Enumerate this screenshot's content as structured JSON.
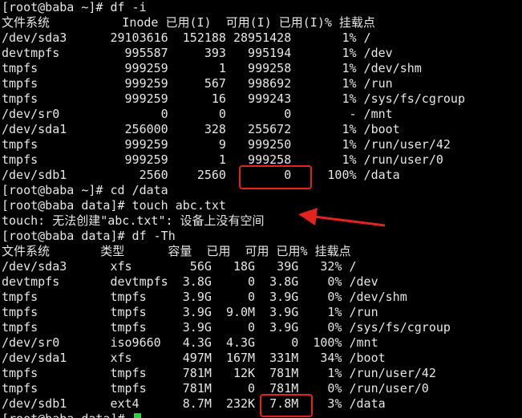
{
  "terminal": {
    "lines": [
      "[root@baba ~]# df -i",
      "文件系统          Inode 已用(I)  可用(I) 已用(I)% 挂载点",
      "/dev/sda3      29103616  152188 28951428       1% /",
      "devtmpfs         995587     393   995194       1% /dev",
      "tmpfs            999259       1   999258       1% /dev/shm",
      "tmpfs            999259     567   998692       1% /run",
      "tmpfs            999259      16   999243       1% /sys/fs/cgroup",
      "/dev/sr0              0       0        0        - /mnt",
      "/dev/sda1        256000     328   255672       1% /boot",
      "tmpfs            999259       9   999250       1% /run/user/42",
      "tmpfs            999259       1   999258       1% /run/user/0",
      "/dev/sdb1          2560    2560        0     100% /data",
      "[root@baba ~]# cd /data",
      "[root@baba data]# touch abc.txt",
      "touch: 无法创建\"abc.txt\": 设备上没有空间",
      "[root@baba data]# df -Th",
      "文件系统       类型      容量  已用  可用 已用% 挂载点",
      "/dev/sda3      xfs        56G   18G   39G   32% /",
      "devtmpfs       devtmpfs  3.8G     0  3.8G    0% /dev",
      "tmpfs          tmpfs     3.9G     0  3.9G    0% /dev/shm",
      "tmpfs          tmpfs     3.9G  9.0M  3.9G    1% /run",
      "tmpfs          tmpfs     3.9G     0  3.9G    0% /sys/fs/cgroup",
      "/dev/sr0       iso9660   4.3G  4.3G     0  100% /mnt",
      "/dev/sda1      xfs       497M  167M  331M   34% /boot",
      "tmpfs          tmpfs     781M   12K  781M    1% /run/user/42",
      "tmpfs          tmpfs     781M     0  781M    0% /run/user/0",
      "/dev/sdb1      ext4      8.7M  232K  7.8M    3% /data",
      "[root@baba data]# "
    ]
  },
  "colors": {
    "background": "#000000",
    "text": "#e6e6e6",
    "cursor": "#22d63b",
    "annotation": "#e3231d"
  }
}
